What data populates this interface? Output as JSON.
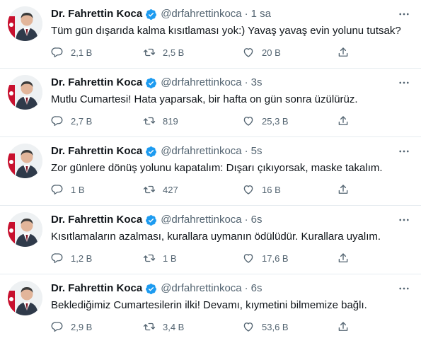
{
  "colors": {
    "verified": "#1d9bf0",
    "icon_gray": "#536471",
    "divider": "#e6ecf0",
    "avatar_red": "#c8102e"
  },
  "icons": {
    "reply": "reply-icon",
    "retweet": "retweet-icon",
    "like": "heart-icon",
    "share": "share-icon",
    "more": "more-icon",
    "verified": "verified-badge-icon"
  },
  "tweets": [
    {
      "name": "Dr. Fahrettin Koca",
      "handle": "@drfahrettinkoca",
      "separator": "·",
      "time": "1 sa",
      "text": "Tüm gün dışarıda kalma kısıtlaması yok:) Yavaş yavaş evin yolunu tutsak?",
      "replies": "2,1 B",
      "retweets": "2,5 B",
      "likes": "20 B"
    },
    {
      "name": "Dr. Fahrettin Koca",
      "handle": "@drfahrettinkoca",
      "separator": "·",
      "time": "3s",
      "text": "Mutlu Cumartesi! Hata yaparsak, bir hafta on gün sonra üzülürüz.",
      "replies": "2,7 B",
      "retweets": "819",
      "likes": "25,3 B"
    },
    {
      "name": "Dr. Fahrettin Koca",
      "handle": "@drfahrettinkoca",
      "separator": "·",
      "time": "5s",
      "text": "Zor günlere dönüş yolunu kapatalım: Dışarı çıkıyorsak, maske takalım.",
      "replies": "1 B",
      "retweets": "427",
      "likes": "16 B"
    },
    {
      "name": "Dr. Fahrettin Koca",
      "handle": "@drfahrettinkoca",
      "separator": "·",
      "time": "6s",
      "text": "Kısıtlamaların azalması, kurallara uymanın ödülüdür. Kurallara uyalım.",
      "replies": "1,2 B",
      "retweets": "1 B",
      "likes": "17,6 B"
    },
    {
      "name": "Dr. Fahrettin Koca",
      "handle": "@drfahrettinkoca",
      "separator": "·",
      "time": "6s",
      "text": "Beklediğimiz Cumartesilerin ilki! Devamı, kıymetini bilmemize bağlı.",
      "replies": "2,9 B",
      "retweets": "3,4 B",
      "likes": "53,6 B"
    }
  ]
}
